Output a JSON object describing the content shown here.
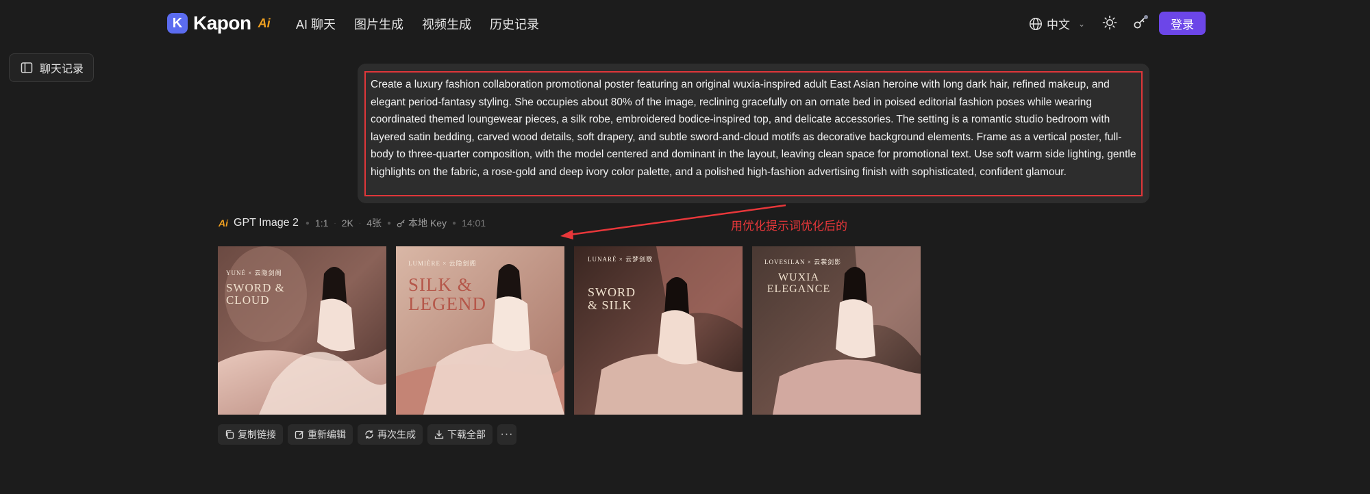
{
  "header": {
    "logo_text": "Kapon",
    "logo_ai": "Ai",
    "nav": [
      "AI 聊天",
      "图片生成",
      "视频生成",
      "历史记录"
    ],
    "language": "中文",
    "login_label": "登录"
  },
  "sidebar": {
    "history_label": "聊天记录"
  },
  "prompt": {
    "text": "Create a luxury fashion collaboration promotional poster featuring an original wuxia-inspired adult East Asian heroine with long dark hair, refined makeup, and elegant period-fantasy styling. She occupies about 80% of the image, reclining gracefully on an ornate bed in poised editorial fashion poses while wearing coordinated themed loungewear pieces, a silk robe, embroidered bodice-inspired top, and delicate accessories. The setting is a romantic studio bedroom with layered satin bedding, carved wood details, soft drapery, and subtle sword-and-cloud motifs as decorative background elements. Frame as a vertical poster, full-body to three-quarter composition, with the model centered and dominant in the layout, leaving clean space for promotional text. Use soft warm side lighting, gentle highlights on the fabric, a rose-gold and deep ivory color palette, and a polished high-fashion advertising finish with sophisticated, confident glamour.",
    "highlight_color": "#e0363a"
  },
  "meta": {
    "ai_badge": "Ai",
    "model": "GPT Image 2",
    "ratio": "1:1",
    "resolution": "2K",
    "count": "4张",
    "key": "本地 Key",
    "time": "14:01"
  },
  "annotation": "用优化提示词优化后的",
  "images": [
    {
      "brand": "YUNÉ × 云隐剑阁",
      "title": "SWORD & CLOUD"
    },
    {
      "brand": "LUMIÈRE × 云隐剑阁",
      "title": "SILK & LEGEND"
    },
    {
      "brand": "LUNARÉ × 云梦剑歌",
      "title": "SWORD & SILK"
    },
    {
      "brand": "LOVESILAN × 云裳剑影",
      "title": "WUXIA ELEGANCE"
    }
  ],
  "actions": {
    "copy_link": "复制链接",
    "re_edit": "重新编辑",
    "regenerate": "再次生成",
    "download_all": "下载全部",
    "more": "···"
  },
  "colors": {
    "background": "#1c1c1c",
    "accent": "#6c46e8",
    "annotation": "#e8373a",
    "logo_blue": "#5b6cf0",
    "ai_orange": "#f0a020"
  }
}
